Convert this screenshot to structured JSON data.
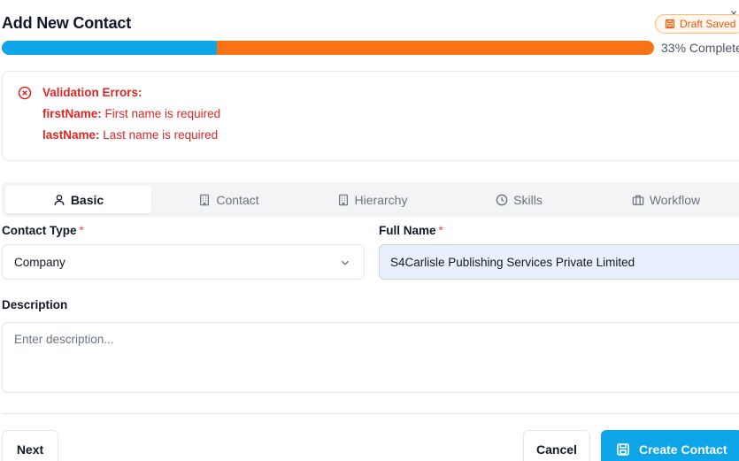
{
  "dialog": {
    "title": "Add New Contact",
    "close_glyph": "×",
    "draft_badge": "Draft Saved"
  },
  "progress": {
    "percent": 33,
    "label": "33% Complete",
    "fill_color": "#0ea5e9",
    "track_color": "#f97316"
  },
  "errors": {
    "title": "Validation Errors:",
    "items": [
      {
        "field": "firstName:",
        "message": "First name is required"
      },
      {
        "field": "lastName:",
        "message": "Last name is required"
      }
    ],
    "color": "#dc2626"
  },
  "tabs": [
    {
      "label": "Basic",
      "icon": "user-icon",
      "active": true
    },
    {
      "label": "Contact",
      "icon": "building-icon",
      "active": false
    },
    {
      "label": "Hierarchy",
      "icon": "building-icon",
      "active": false
    },
    {
      "label": "Skills",
      "icon": "clock-icon",
      "active": false
    },
    {
      "label": "Workflow",
      "icon": "briefcase-icon",
      "active": false
    }
  ],
  "form": {
    "contact_type": {
      "label": "Contact Type",
      "required_mark": "*",
      "value": "Company"
    },
    "full_name": {
      "label": "Full Name",
      "required_mark": "*",
      "value": "S4Carlisle Publishing Services Private Limited"
    },
    "description": {
      "label": "Description",
      "placeholder": "Enter description...",
      "value": ""
    }
  },
  "footer": {
    "next_label": "Next",
    "cancel_label": "Cancel",
    "create_label": "Create Contact",
    "accent": "#0ea5e9"
  }
}
